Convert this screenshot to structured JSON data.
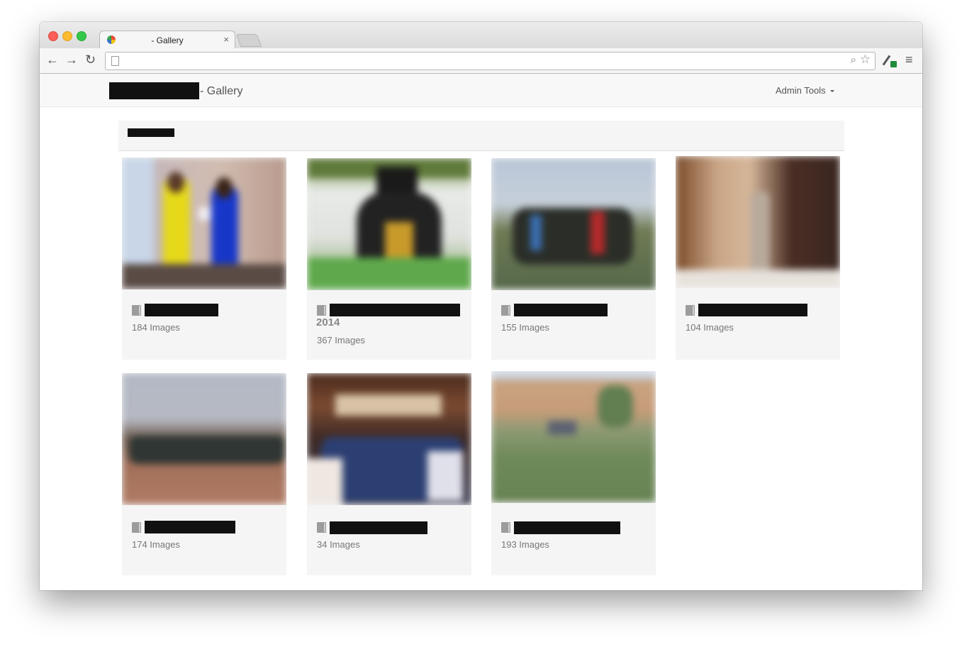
{
  "browser": {
    "tab_title": "- Gallery",
    "tab_close": "×",
    "back_glyph": "←",
    "forward_glyph": "→",
    "reload_glyph": "↻",
    "zoom_glyph": "⌕",
    "star_glyph": "☆",
    "menu_glyph": "≡",
    "url": ""
  },
  "navbar": {
    "brand_suffix": "- Gallery",
    "admin_tools_label": "Admin Tools"
  },
  "albums": [
    {
      "count_label": "184 Images",
      "year": ""
    },
    {
      "count_label": "367 Images",
      "year": "2014"
    },
    {
      "count_label": "155 Images",
      "year": ""
    },
    {
      "count_label": "104 Images",
      "year": ""
    },
    {
      "count_label": "174 Images",
      "year": ""
    },
    {
      "count_label": "34 Images",
      "year": ""
    },
    {
      "count_label": "193 Images",
      "year": ""
    }
  ],
  "colors": {
    "navbar_bg": "#f8f8f8",
    "card_bg": "#f5f5f5",
    "redaction": "#111111"
  }
}
